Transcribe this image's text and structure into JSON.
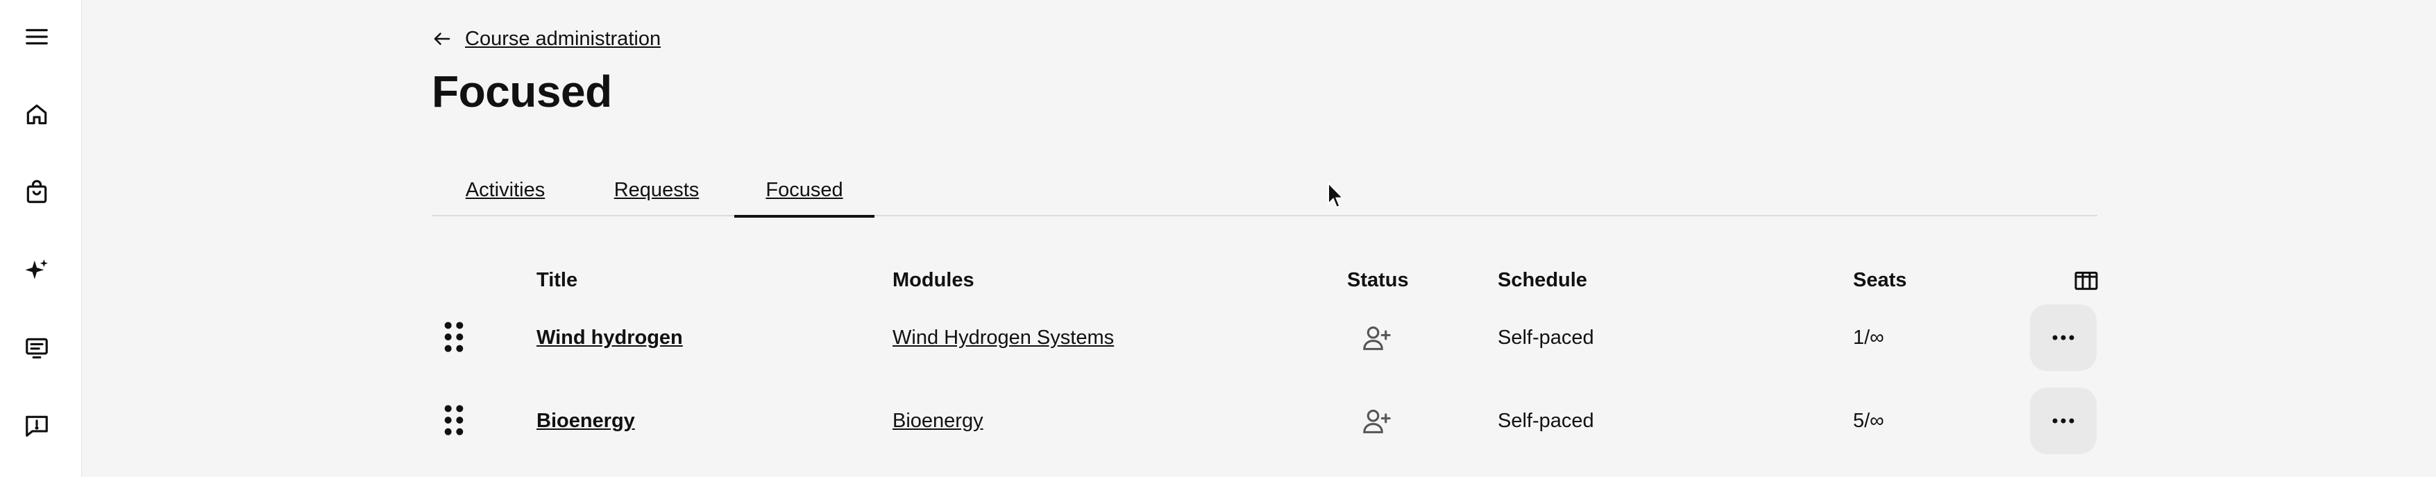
{
  "sidebar": {
    "items": [
      {
        "icon": "menu-icon"
      },
      {
        "icon": "home-icon"
      },
      {
        "icon": "shopping-bag-icon"
      },
      {
        "icon": "sparkle-icon"
      },
      {
        "icon": "presentation-icon"
      },
      {
        "icon": "feedback-icon"
      }
    ]
  },
  "header": {
    "back_label": "Course administration",
    "title": "Focused"
  },
  "tabs": [
    {
      "label": "Activities",
      "active": false
    },
    {
      "label": "Requests",
      "active": false
    },
    {
      "label": "Focused",
      "active": true
    }
  ],
  "table": {
    "columns": {
      "title": "Title",
      "modules": "Modules",
      "status": "Status",
      "schedule": "Schedule",
      "seats": "Seats"
    },
    "rows": [
      {
        "title": "Wind hydrogen",
        "module": "Wind Hydrogen Systems",
        "status_icon": "add-person-icon",
        "schedule": "Self-paced",
        "seats": "1/∞"
      },
      {
        "title": "Bioenergy",
        "module": "Bioenergy",
        "status_icon": "add-person-icon",
        "schedule": "Self-paced",
        "seats": "5/∞"
      }
    ]
  },
  "colors": {
    "background": "#f5f5f5",
    "sidebar": "#ffffff",
    "text": "#111111",
    "divider": "#dcdcdc",
    "button_bg": "#e9e9e9"
  }
}
